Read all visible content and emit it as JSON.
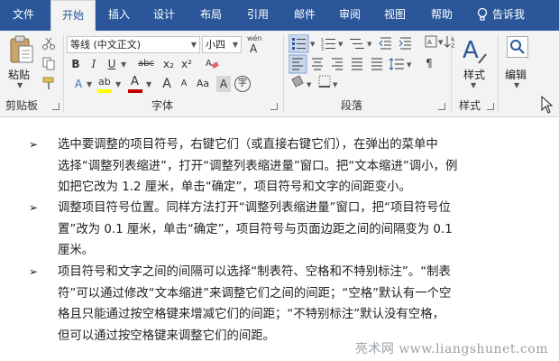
{
  "tabs": [
    "文件",
    "开始",
    "插入",
    "设计",
    "布局",
    "引用",
    "邮件",
    "审阅",
    "视图",
    "帮助"
  ],
  "active_tab": "开始",
  "tell_me": "告诉我",
  "clipboard": {
    "paste_label": "粘贴",
    "group_label": "剪贴板"
  },
  "font": {
    "name_value": "等线 (中文正文)",
    "size_value": "小四",
    "wen_glyph": "wén",
    "wen_char": "A",
    "group_label": "字体",
    "buttons": {
      "bold": "B",
      "italic": "I",
      "underline": "U",
      "strike": "abc",
      "sub": "x₂",
      "sup": "x²",
      "grow": "A",
      "shrink": "A",
      "case": "Aa",
      "char_border": "A",
      "phonetic": "字",
      "highlight": "ab",
      "color": "A",
      "shading": "A",
      "effects": "A"
    }
  },
  "paragraph": {
    "group_label": "段落"
  },
  "styles": {
    "label": "样式",
    "group_label": "样式"
  },
  "editing": {
    "label": "编辑"
  },
  "body": {
    "items": [
      {
        "lines": [
          "选中要调整的项目符号，右键它们（或直接右键它们），在弹出的菜单中",
          "选择“调整列表缩进”，打开“调整列表缩进量”窗口。把“文本缩进”调小，例",
          "如把它改为 1.2 厘米，单击“确定”，项目符号和文字的间距变小。"
        ]
      },
      {
        "lines": [
          "调整项目符号位置。同样方法打开“调整列表缩进量”窗口，把“项目符号位",
          "置”改为 0.1 厘米，单击“确定”，项目符号与页面边距之间的间隔变为 0.1",
          "厘米。"
        ]
      },
      {
        "lines": [
          "项目符号和文字之间的间隔可以选择“制表符、空格和不特别标注”。“制表",
          "符”可以通过修改“文本缩进”来调整它们之间的间距；“空格”默认有一个空",
          "格且只能通过按空格键来增减它们的间距；“不特别标注”默认没有空格，",
          "但可以通过按空格键来调整它们的间距。"
        ]
      }
    ],
    "bullet_glyph": "➢"
  },
  "watermark": "亮术网 www.liangshunet.com",
  "colors": {
    "brand": "#2b579a",
    "highlight": "#ffff00",
    "font_color": "#c00000",
    "ribbon_bg": "#f3f3f3"
  }
}
